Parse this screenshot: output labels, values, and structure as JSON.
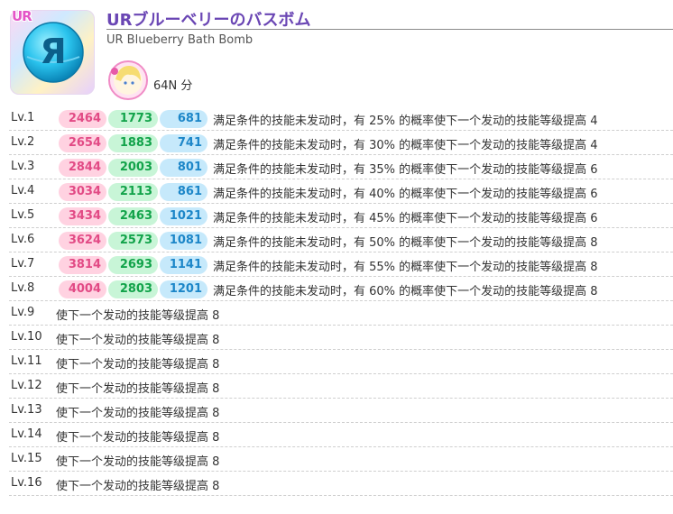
{
  "item": {
    "rarity": "UR",
    "title": "URブルーベリーのバスボム",
    "subtitle": "UR Blueberry Bath Bomb",
    "cost": "64N 分",
    "orb_letter": "Я",
    "colors": {
      "title": "#6a46b4",
      "smile": "#e24a85",
      "pure": "#12a34a",
      "cool": "#1c86c8"
    }
  },
  "levels": [
    {
      "lv": "Lv.1",
      "smile": "2464",
      "pure": "1773",
      "cool": "681",
      "skill": "满足条件的技能未发动时，有 25% 的概率使下一个发动的技能等级提高 4"
    },
    {
      "lv": "Lv.2",
      "smile": "2654",
      "pure": "1883",
      "cool": "741",
      "skill": "满足条件的技能未发动时，有 30% 的概率使下一个发动的技能等级提高 4"
    },
    {
      "lv": "Lv.3",
      "smile": "2844",
      "pure": "2003",
      "cool": "801",
      "skill": "满足条件的技能未发动时，有 35% 的概率使下一个发动的技能等级提高 6"
    },
    {
      "lv": "Lv.4",
      "smile": "3034",
      "pure": "2113",
      "cool": "861",
      "skill": "满足条件的技能未发动时，有 40% 的概率使下一个发动的技能等级提高 6"
    },
    {
      "lv": "Lv.5",
      "smile": "3434",
      "pure": "2463",
      "cool": "1021",
      "skill": "满足条件的技能未发动时，有 45% 的概率使下一个发动的技能等级提高 6"
    },
    {
      "lv": "Lv.6",
      "smile": "3624",
      "pure": "2573",
      "cool": "1081",
      "skill": "满足条件的技能未发动时，有 50% 的概率使下一个发动的技能等级提高 8"
    },
    {
      "lv": "Lv.7",
      "smile": "3814",
      "pure": "2693",
      "cool": "1141",
      "skill": "满足条件的技能未发动时，有 55% 的概率使下一个发动的技能等级提高 8"
    },
    {
      "lv": "Lv.8",
      "smile": "4004",
      "pure": "2803",
      "cool": "1201",
      "skill": "满足条件的技能未发动时，有 60% 的概率使下一个发动的技能等级提高 8"
    }
  ],
  "extra_levels": [
    {
      "lv": "Lv.9",
      "skill": "使下一个发动的技能等级提高 8"
    },
    {
      "lv": "Lv.10",
      "skill": "使下一个发动的技能等级提高 8"
    },
    {
      "lv": "Lv.11",
      "skill": "使下一个发动的技能等级提高 8"
    },
    {
      "lv": "Lv.12",
      "skill": "使下一个发动的技能等级提高 8"
    },
    {
      "lv": "Lv.13",
      "skill": "使下一个发动的技能等级提高 8"
    },
    {
      "lv": "Lv.14",
      "skill": "使下一个发动的技能等级提高 8"
    },
    {
      "lv": "Lv.15",
      "skill": "使下一个发动的技能等级提高 8"
    },
    {
      "lv": "Lv.16",
      "skill": "使下一个发动的技能等级提高 8"
    }
  ]
}
